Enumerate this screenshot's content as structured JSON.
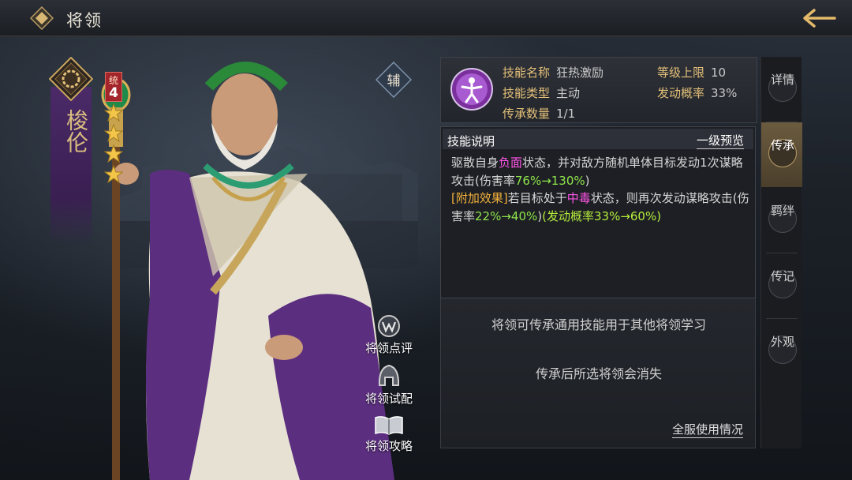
{
  "page_title": "将领",
  "hero": {
    "name": "梭伦",
    "tong_label": "统",
    "tong_value": "4",
    "stars": 4,
    "aux_label": "辅"
  },
  "actions": [
    {
      "label": "将领点评",
      "icon": "review-icon"
    },
    {
      "label": "将领试配",
      "icon": "helmet-icon"
    },
    {
      "label": "将领攻略",
      "icon": "book-icon"
    }
  ],
  "skill": {
    "name_key": "技能名称",
    "name_value": "狂热激励",
    "type_key": "技能类型",
    "type_value": "主动",
    "count_key": "传承数量",
    "count_value": "1/1",
    "level_key": "等级上限",
    "level_value": "10",
    "prob_key": "发动概率",
    "prob_value": "33%"
  },
  "description": {
    "title": "技能说明",
    "preview": "一级预览",
    "seg": {
      "a": "驱散自身",
      "b": "负面",
      "c": "状态，并对敌方随机单体目标发动1次谋略攻击(伤害率",
      "d": "76%→130%",
      "e": ")",
      "f": "[附加效果]",
      "g": "若目标处于",
      "h": "中毒",
      "i": "状态，则再次发动谋略攻击(伤害率",
      "j": "22%→40%",
      "k": ")",
      "l": "(发动概率33%→60%)"
    }
  },
  "info": {
    "line1": "将领可传承通用技能用于其他将领学习",
    "line2": "传承后所选将领会消失",
    "server_usage": "全服使用情况"
  },
  "tabs": [
    {
      "label": "详情",
      "active": false
    },
    {
      "label": "传承",
      "active": true
    },
    {
      "label": "羁绊",
      "active": false
    },
    {
      "label": "传记",
      "active": false
    },
    {
      "label": "外观",
      "active": false
    }
  ],
  "colors": {
    "negative_keyword": "#ff55e8",
    "extra_effect": "#f4b13b",
    "value_highlight": "#8fe54b",
    "key_gold": "#e4c079",
    "hero_purple": "#4b2a68"
  }
}
